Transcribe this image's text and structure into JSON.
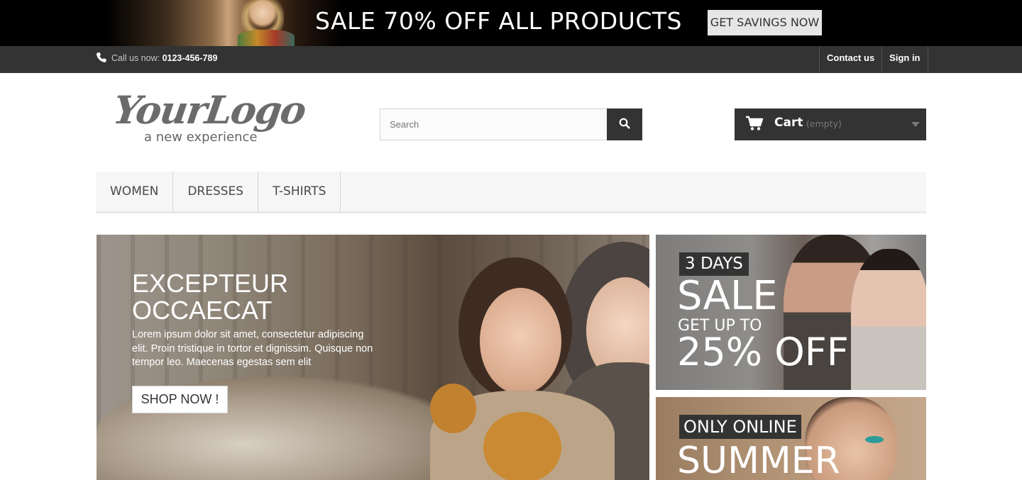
{
  "promo_banner": {
    "headline": "SALE 70% OFF ALL PRODUCTS",
    "button_label": "GET SAVINGS NOW"
  },
  "top_nav": {
    "phone_label": "Call us now: ",
    "phone_number": "0123-456-789",
    "links": [
      "Contact us",
      "Sign in"
    ]
  },
  "header": {
    "logo_script": "YourLogo",
    "logo_tagline": "a new experience",
    "search_placeholder": "Search",
    "search_value": "",
    "cart_label": "Cart",
    "cart_status": "(empty)"
  },
  "menu": {
    "items": [
      "WOMEN",
      "DRESSES",
      "T-SHIRTS"
    ]
  },
  "slider": {
    "title": "EXCEPTEUR OCCAECAT",
    "text": "Lorem ipsum dolor sit amet, consectetur adipiscing elit. Proin tristique in tortor et dignissim. Quisque non tempor leo. Maecenas egestas sem elit",
    "button_label": "SHOP NOW !"
  },
  "side_banners": [
    {
      "tag": "3 DAYS",
      "big": "SALE",
      "mid": "GET UP TO",
      "off": "25% OFF"
    },
    {
      "tag": "ONLY ONLINE",
      "big": "SUMMER"
    }
  ],
  "colors": {
    "dark": "#333333",
    "black": "#000000",
    "menu_bg": "#f6f6f6",
    "light_button": "#e6e6e6"
  },
  "icons": [
    "phone-icon",
    "search-icon",
    "cart-icon",
    "caret-down-icon"
  ]
}
